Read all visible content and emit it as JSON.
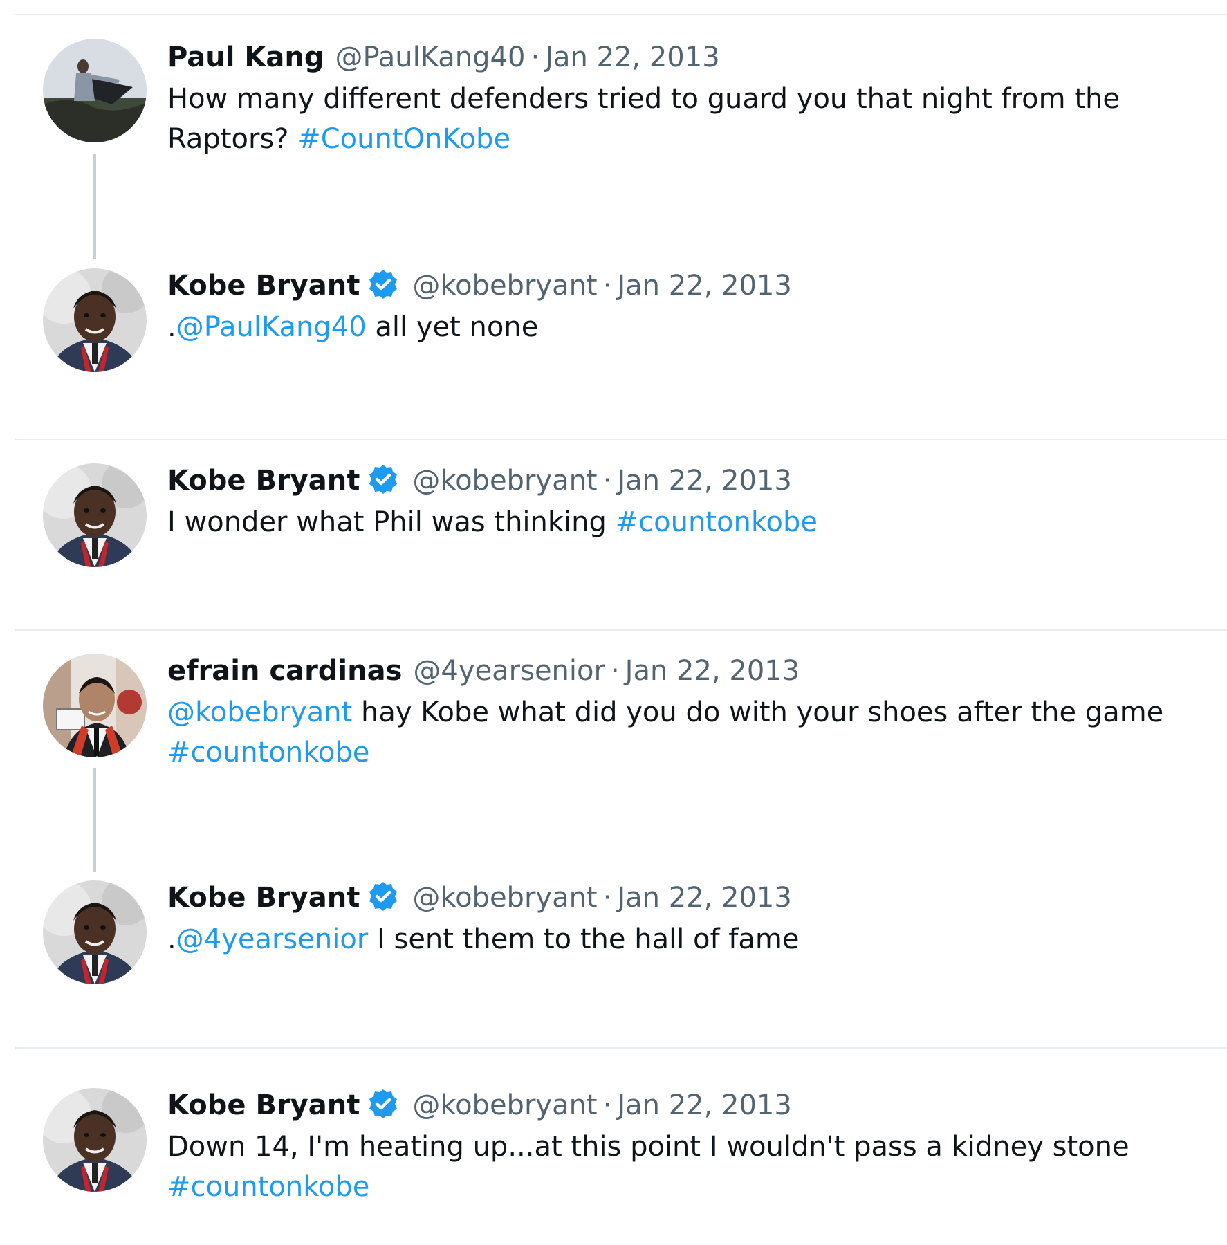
{
  "colors": {
    "link": "#1d9bf0",
    "verified": "#1d9bf0",
    "secondary_text": "#536471",
    "divider": "#e6ecf0",
    "thread_line": "#c4cfd6"
  },
  "tweets": [
    {
      "name": "Paul Kang",
      "handle": "@PaulKang40",
      "sep": "·",
      "date": "Jan 22, 2013",
      "verified": false,
      "avatar": "avatar-photo-person-kite",
      "text_plain": "How many different defenders tried to guard you that night from the Raptors? ",
      "text_link": "#CountOnKobe"
    },
    {
      "name": "Kobe Bryant",
      "handle": "@kobebryant",
      "sep": "·",
      "date": "Jan 22, 2013",
      "verified": true,
      "avatar": "avatar-photo-child-portrait",
      "text_prefix": ".",
      "text_link": "@PaulKang40",
      "text_plain": " all yet none"
    },
    {
      "name": "Kobe Bryant",
      "handle": "@kobebryant",
      "sep": "·",
      "date": "Jan 22, 2013",
      "verified": true,
      "avatar": "avatar-photo-child-portrait",
      "text_plain": "I wonder what Phil was thinking ",
      "text_link": "#countonkobe"
    },
    {
      "name": "efrain cardinas",
      "handle": "@4yearsenior",
      "sep": "·",
      "date": "Jan 22, 2013",
      "verified": false,
      "avatar": "avatar-photo-graduate",
      "text_link": "@kobebryant",
      "text_plain": " hay Kobe what did you do with your shoes after the game ",
      "text_link2": "#countonkobe"
    },
    {
      "name": "Kobe Bryant",
      "handle": "@kobebryant",
      "sep": "·",
      "date": "Jan 22, 2013",
      "verified": true,
      "avatar": "avatar-photo-child-portrait",
      "text_prefix": ".",
      "text_link": "@4yearsenior",
      "text_plain": " I sent them to the hall of fame"
    },
    {
      "name": "Kobe Bryant",
      "handle": "@kobebryant",
      "sep": "·",
      "date": "Jan 22, 2013",
      "verified": true,
      "avatar": "avatar-photo-child-portrait",
      "text_plain": "Down 14, I'm heating up...at this point I wouldn't pass a kidney stone ",
      "text_link": "#countonkobe"
    }
  ]
}
